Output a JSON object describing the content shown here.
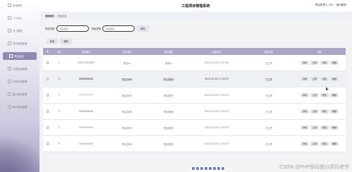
{
  "header": {
    "title": "工程项目管理系统",
    "user_text": "项目负责人 222",
    "logout_label": "退出登录"
  },
  "sidebar": {
    "items": [
      {
        "label": "系统首页",
        "icon": "home-icon"
      },
      {
        "label": "个人中心",
        "icon": "user-icon"
      },
      {
        "label": "员工管理",
        "icon": "team-icon"
      },
      {
        "label": "项目信息管理",
        "icon": "folder-icon"
      },
      {
        "label": "项目信息",
        "icon": "doc-icon",
        "active": true
      },
      {
        "label": "立项信息管理",
        "icon": "flag-icon"
      },
      {
        "label": "方案评审管理",
        "icon": "check-icon"
      },
      {
        "label": "施工情况管理",
        "icon": "build-icon"
      },
      {
        "label": "审计报告管理",
        "icon": "report-icon"
      }
    ]
  },
  "breadcrumb": {
    "home": "系统首页",
    "sep": "/",
    "current": "项目信息"
  },
  "search": {
    "name_label": "项目名称",
    "name_placeholder": "项目名称",
    "type_label": "项目类型",
    "type_placeholder": "项目类型",
    "button_label": "查询"
  },
  "actions": {
    "add_label": "新增",
    "delete_label": "删除"
  },
  "table": {
    "headers": [
      "索引",
      "项目编号",
      "项目名称",
      "项目类型",
      "创建时间",
      "项目状态",
      "操作"
    ],
    "ops": [
      "详情",
      "立项",
      "修改",
      "删除"
    ],
    "rows": [
      {
        "idx": "1",
        "no": "168741914865",
        "name": "项目xx",
        "type": "类型xx",
        "time": "2023-04-18 17:43:36",
        "status": "已立项"
      },
      {
        "idx": "2",
        "no": "8888888888",
        "name": "项目名称8",
        "type": "项目类型8",
        "time": "2023-04-18 17:03:23",
        "status": "已立项"
      },
      {
        "idx": "3",
        "no": "7777777777",
        "name": "项目名称7",
        "type": "项目类型7",
        "time": "2023-04-18 17:03:23",
        "status": "已立项"
      },
      {
        "idx": "4",
        "no": "6666666666",
        "name": "项目名称6",
        "type": "项目类型6",
        "time": "2023-04-18 17:03:23",
        "status": "已立项"
      },
      {
        "idx": "5",
        "no": "5555555555",
        "name": "项目名称5",
        "type": "项目类型5",
        "time": "2023-04-18 17:03:23",
        "status": "已立项"
      },
      {
        "idx": "6",
        "no": "4444444444",
        "name": "项目名称4",
        "type": "项目类型4",
        "time": "2023-04-18 17:03:23",
        "status": "已立项"
      }
    ]
  },
  "watermark": "CSDN @PHP源码部分原码老爷"
}
